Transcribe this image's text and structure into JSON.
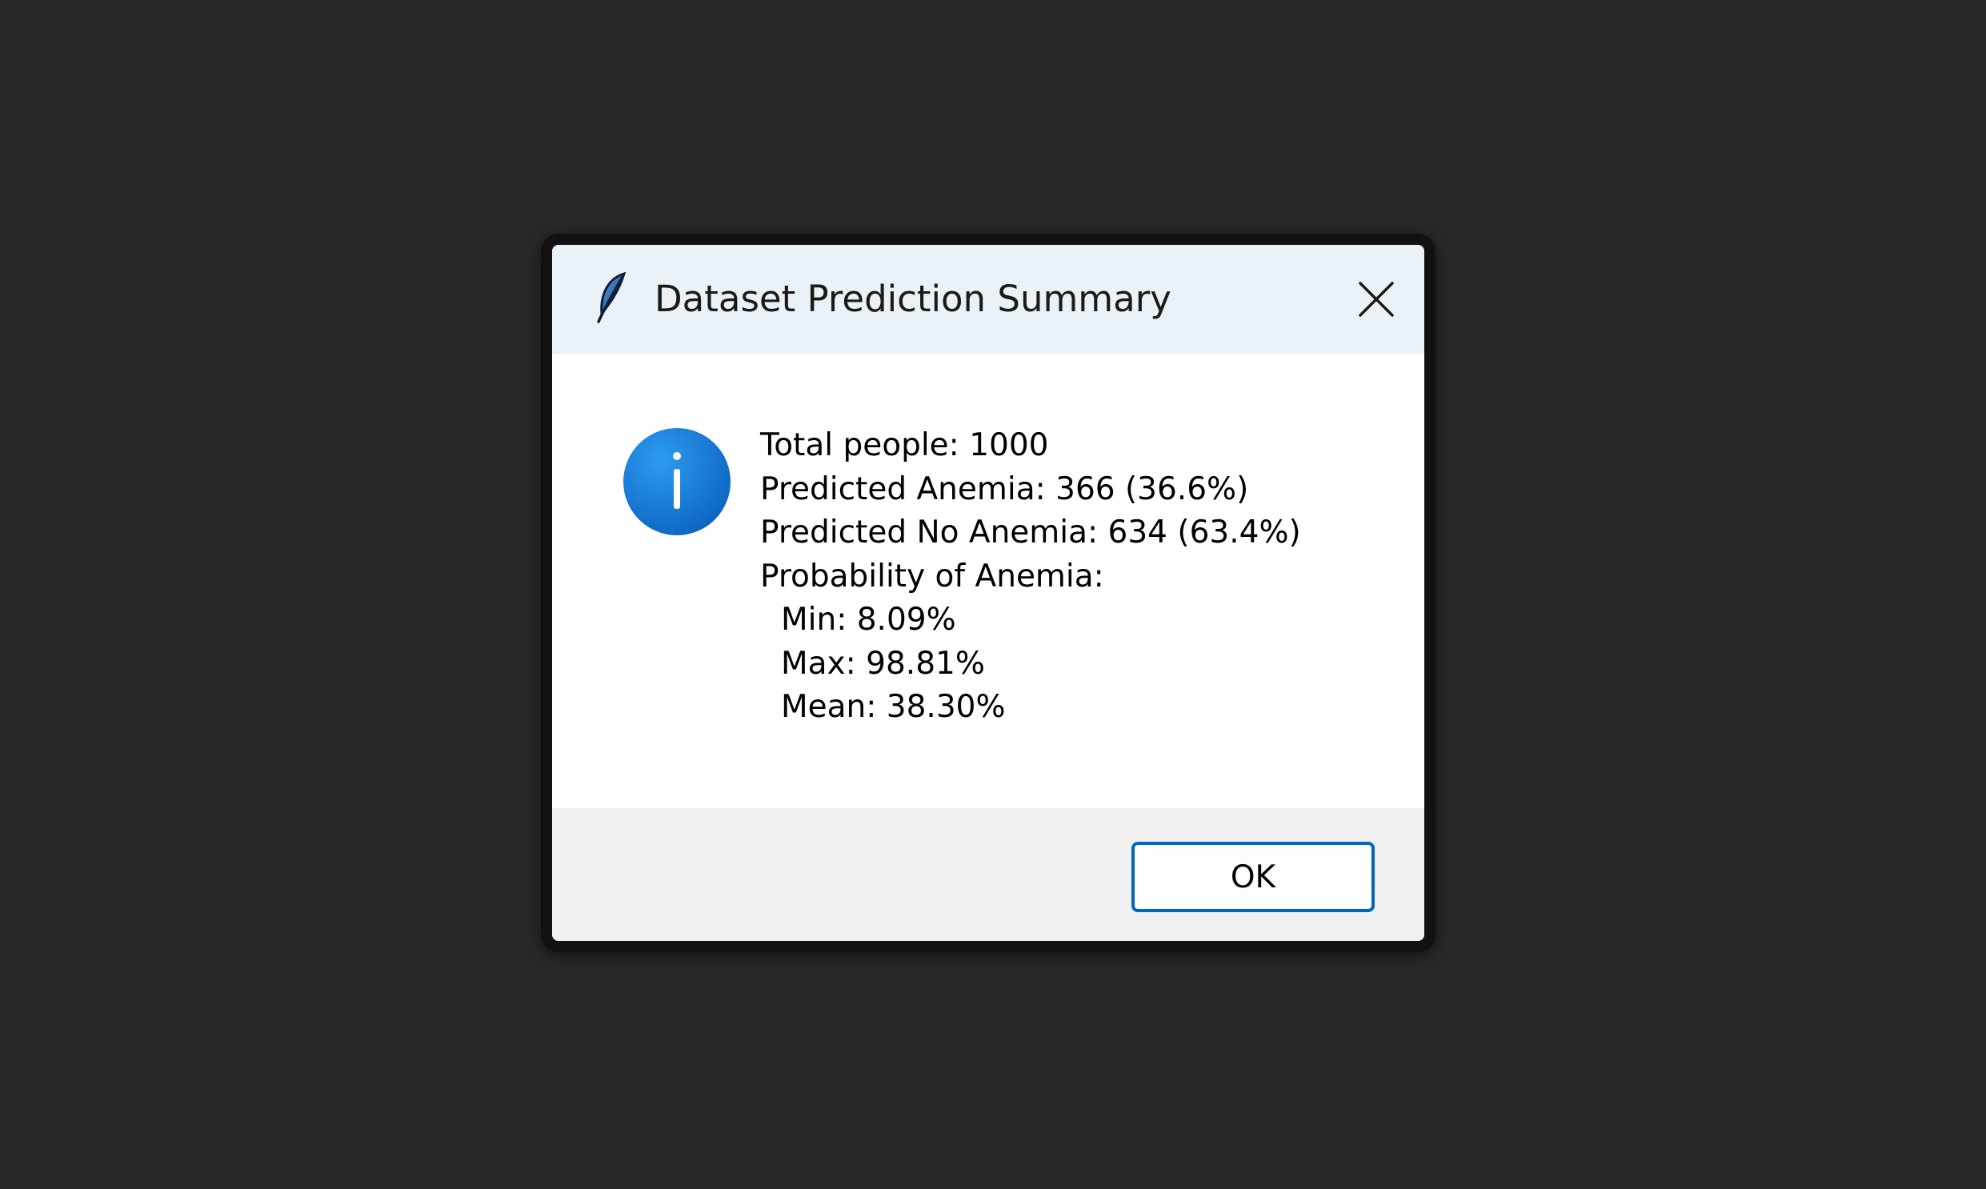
{
  "dialog": {
    "title": "Dataset Prediction Summary",
    "app_icon": "feather-icon",
    "close_icon": "close-icon",
    "message_icon": "info-icon",
    "message_lines": [
      "Total people: 1000",
      "Predicted Anemia: 366 (36.6%)",
      "Predicted No Anemia: 634 (63.4%)",
      "Probability of Anemia:"
    ],
    "stats": {
      "min": "Min: 8.09%",
      "max": "Max: 98.81%",
      "mean": "Mean: 38.30%"
    },
    "ok_label": "OK"
  },
  "colors": {
    "desktop_background": "#282828",
    "titlebar": "#eaf2f8",
    "footer": "#f0f0f0",
    "accent": "#0067c0",
    "info_icon": "#0a7ad6"
  }
}
